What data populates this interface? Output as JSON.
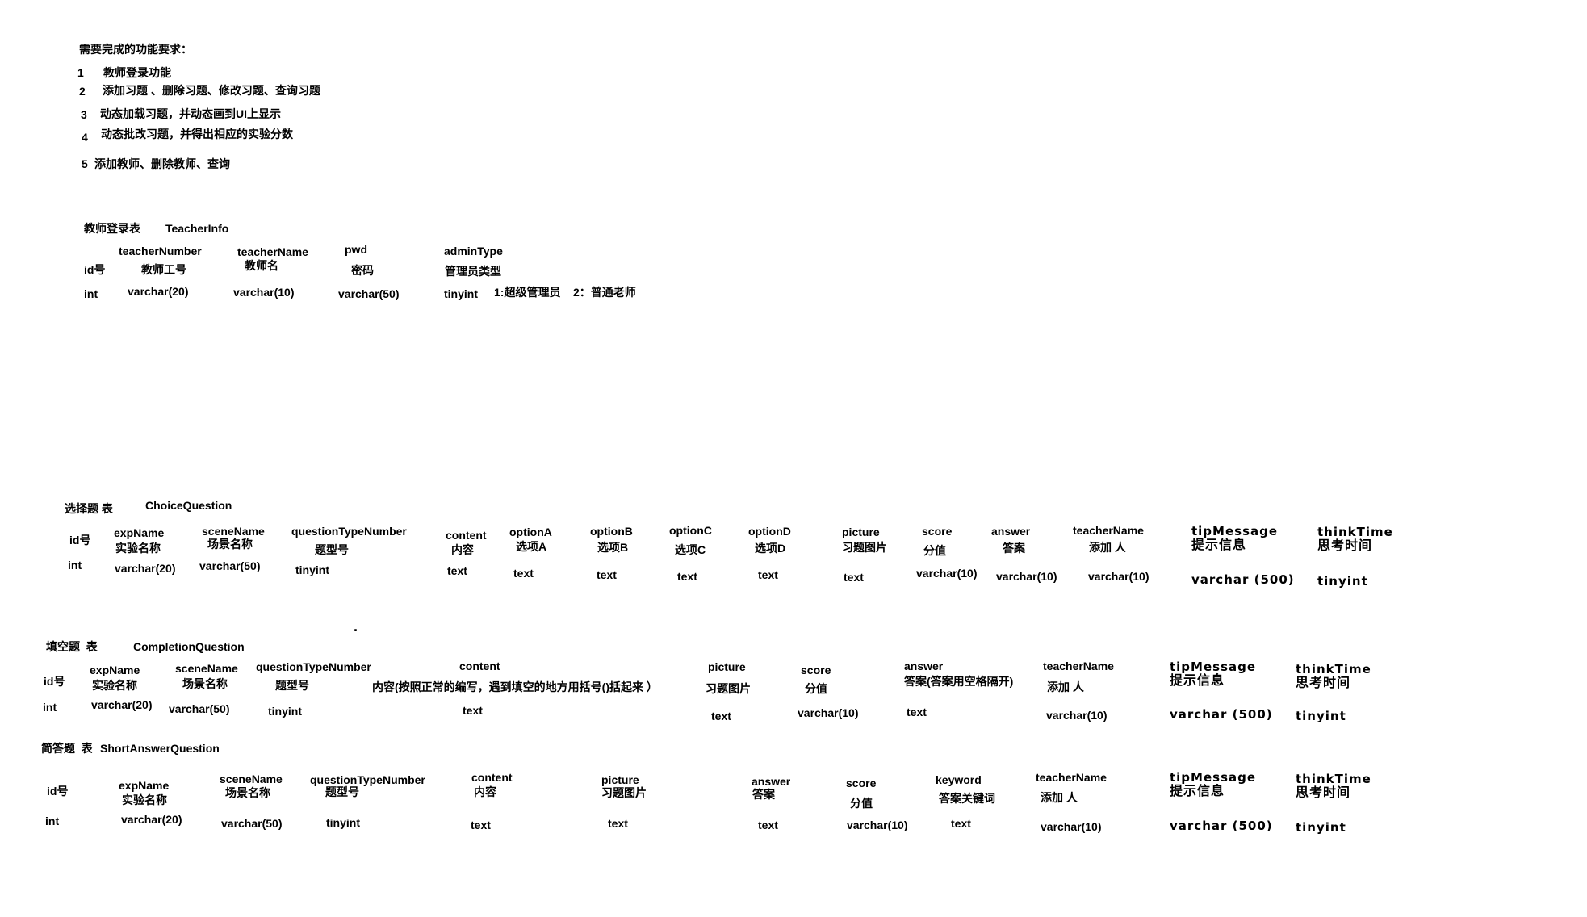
{
  "requirements": {
    "title": "需要完成的功能要求：",
    "items": [
      {
        "num": "1",
        "text": "教师登录功能"
      },
      {
        "num": "2",
        "text": "添加习题 、删除习题、修改习题、查询习题"
      },
      {
        "num": "3",
        "text": "动态加载习题，并动态画到UI上显示"
      },
      {
        "num": "4",
        "text": "动态批改习题，并得出相应的实验分数"
      },
      {
        "num": "5",
        "text": "添加教师、删除教师、查询"
      }
    ]
  },
  "teacher_table": {
    "label": "教师登录表",
    "name": "TeacherInfo",
    "columns": [
      {
        "desc": "id号",
        "type": "int"
      },
      {
        "field": "teacherNumber",
        "desc": "教师工号",
        "type": "varchar(20)"
      },
      {
        "field": "teacherName",
        "desc": "教师名",
        "type": "varchar(10)"
      },
      {
        "field": "pwd",
        "desc": "密码",
        "type": "varchar(50)"
      },
      {
        "field": "adminType",
        "desc": "管理员类型",
        "type": "tinyint",
        "notes": [
          "1:超级管理员",
          "2：普通老师"
        ]
      }
    ]
  },
  "choice_table": {
    "label": "选择题 表",
    "name": "ChoiceQuestion",
    "columns": [
      {
        "desc": "id号",
        "type": "int"
      },
      {
        "field": "expName",
        "desc": "实验名称",
        "type": "varchar(20)"
      },
      {
        "field": "sceneName",
        "desc": "场景名称",
        "type": "varchar(50)"
      },
      {
        "field": "questionTypeNumber",
        "desc": "题型号",
        "type": "tinyint"
      },
      {
        "field": "content",
        "desc": "内容",
        "type": "text"
      },
      {
        "field": "optionA",
        "desc": "选项A",
        "type": "text"
      },
      {
        "field": "optionB",
        "desc": "选项B",
        "type": "text"
      },
      {
        "field": "optionC",
        "desc": "选项C",
        "type": "text"
      },
      {
        "field": "optionD",
        "desc": "选项D",
        "type": "text"
      },
      {
        "field": "picture",
        "desc": "习题图片",
        "type": "text"
      },
      {
        "field": "score",
        "desc": "分值",
        "type": "varchar(10)"
      },
      {
        "field": "answer",
        "desc": "答案",
        "type": "varchar(10)"
      },
      {
        "field": "teacherName",
        "desc": "添加 人",
        "type": "varchar(10)"
      },
      {
        "field": "tipMessage",
        "desc": "提示信息",
        "type": "varchar (500)"
      },
      {
        "field": "thinkTime",
        "desc": "思考时间",
        "type": "tinyint"
      }
    ]
  },
  "stray_mark": ".",
  "completion_table": {
    "label": "填空题  表",
    "name": "CompletionQuestion",
    "columns": [
      {
        "desc": "id号",
        "type": "int"
      },
      {
        "field": "expName",
        "desc": "实验名称",
        "type": "varchar(20)"
      },
      {
        "field": "sceneName",
        "desc": "场景名称",
        "type": "varchar(50)"
      },
      {
        "field": "questionTypeNumber",
        "desc": "题型号",
        "type": "tinyint"
      },
      {
        "field": "content",
        "desc": "内容(按照正常的编写，遇到填空的地方用括号()括起来 ）",
        "type": "text"
      },
      {
        "field": "picture",
        "desc": "习题图片",
        "type": "text"
      },
      {
        "field": "score",
        "desc": "分值",
        "type": "varchar(10)"
      },
      {
        "field": "answer",
        "desc": "答案(答案用空格隔开)",
        "type": "text"
      },
      {
        "field": "teacherName",
        "desc": "添加 人",
        "type": "varchar(10)"
      },
      {
        "field": "tipMessage",
        "desc": "提示信息",
        "type": "varchar (500)"
      },
      {
        "field": "thinkTime",
        "desc": "思考时间",
        "type": "tinyint"
      }
    ]
  },
  "short_answer_table": {
    "label": "简答题  表",
    "name": "ShortAnswerQuestion",
    "columns": [
      {
        "desc": "id号",
        "type": "int"
      },
      {
        "field": "expName",
        "desc": "实验名称",
        "type": "varchar(20)"
      },
      {
        "field": "sceneName",
        "desc": "场景名称",
        "type": "varchar(50)"
      },
      {
        "field": "questionTypeNumber",
        "desc": "题型号",
        "type": "tinyint"
      },
      {
        "field": "content",
        "desc": "内容",
        "type": "text"
      },
      {
        "field": "picture",
        "desc": "习题图片",
        "type": "text"
      },
      {
        "field": "answer",
        "desc": "答案",
        "type": "text"
      },
      {
        "field": "score",
        "desc": "分值",
        "type": "varchar(10)"
      },
      {
        "field": "keyword",
        "desc": "答案关键词",
        "type": "text"
      },
      {
        "field": "teacherName",
        "desc": "添加 人",
        "type": "varchar(10)"
      },
      {
        "field": "tipMessage",
        "desc": "提示信息",
        "type": "varchar (500)"
      },
      {
        "field": "thinkTime",
        "desc": "思考时间",
        "type": "tinyint"
      }
    ]
  }
}
